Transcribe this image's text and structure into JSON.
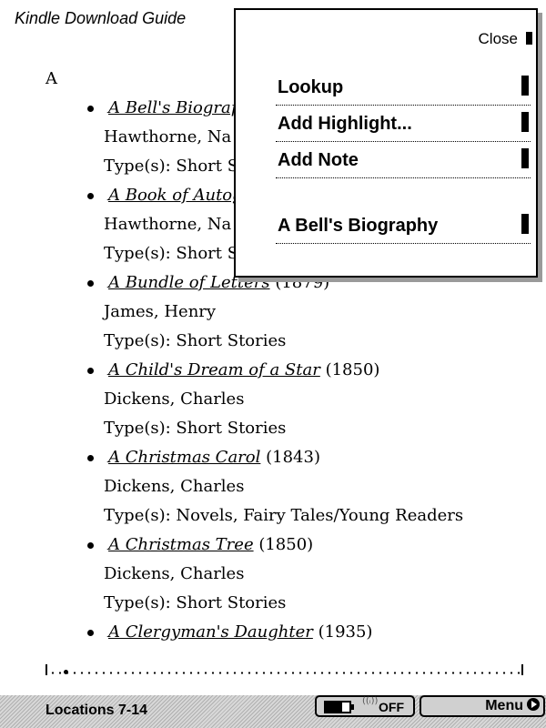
{
  "document": {
    "title": "Kindle Download Guide",
    "section_letter": "A"
  },
  "books": [
    {
      "title": "A Bell's Biograp",
      "year": "",
      "author": "Hawthorne, Na",
      "types": "Type(s): Short S"
    },
    {
      "title": "A Book of Autog",
      "year": "",
      "author": "Hawthorne, Na",
      "types": "Type(s): Short S"
    },
    {
      "title": "A Bundle of Letters",
      "year": "(1879)",
      "author": "James, Henry",
      "types": "Type(s): Short Stories"
    },
    {
      "title": "A Child's Dream of a Star",
      "year": "(1850)",
      "author": "Dickens, Charles",
      "types": "Type(s): Short Stories"
    },
    {
      "title": "A Christmas Carol",
      "year": "(1843)",
      "author": "Dickens, Charles",
      "types": "Type(s): Novels, Fairy Tales/Young Readers"
    },
    {
      "title": "A Christmas Tree",
      "year": "(1850)",
      "author": "Dickens, Charles",
      "types": "Type(s): Short Stories"
    },
    {
      "title": "A Clergyman's Daughter",
      "year": "(1935)",
      "author": "",
      "types": ""
    }
  ],
  "popup": {
    "close_label": "Close",
    "items": [
      {
        "label": "Lookup"
      },
      {
        "label": "Add Highlight..."
      },
      {
        "label": "Add Note"
      },
      {
        "label": "A Bell's Biography"
      }
    ]
  },
  "status_bar": {
    "locations": "Locations 7-14",
    "battery_icon": "battery-icon",
    "wireless_icon": "wireless-icon",
    "wireless_state": "OFF",
    "menu_label": "Menu"
  },
  "progress": {
    "fraction": 0.02
  }
}
